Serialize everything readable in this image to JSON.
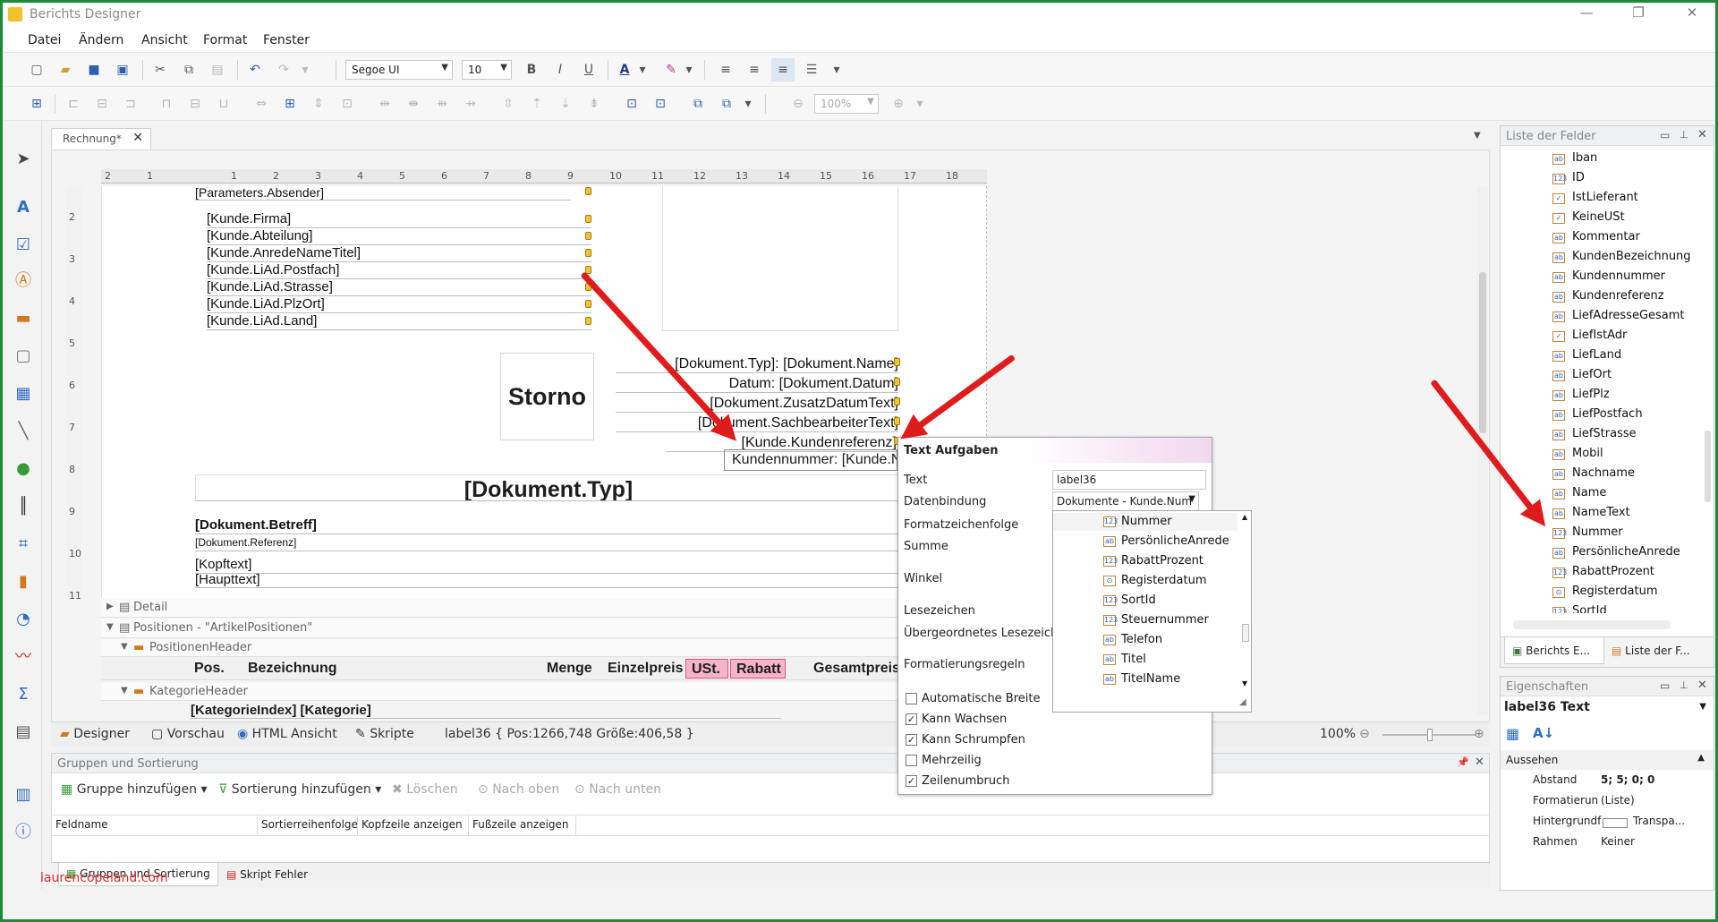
{
  "window": {
    "title": "Berichts Designer",
    "min": "—",
    "max": "❐",
    "close": "✕"
  },
  "menu": [
    "Datei",
    "Ändern",
    "Ansicht",
    "Format",
    "Fenster"
  ],
  "toolbar": {
    "font": "Segoe UI",
    "size": "10",
    "zoom": "100%"
  },
  "doc_tab": {
    "label": "Rechnung*",
    "close": "✕"
  },
  "ruler_h": [
    "2",
    "1",
    "",
    "1",
    "2",
    "3",
    "4",
    "5",
    "6",
    "7",
    "8",
    "9",
    "10",
    "11",
    "12",
    "13",
    "14",
    "15",
    "16",
    "17",
    "18"
  ],
  "ruler_v": [
    "2",
    "3",
    "4",
    "5",
    "6",
    "7",
    "8",
    "9",
    "10",
    "11"
  ],
  "report": {
    "absender": "[Parameters.Absender]",
    "address": [
      "[Kunde.Firma]",
      "[Kunde.Abteilung]",
      "[Kunde.AnredeNameTitel]",
      "[Kunde.LiAd.Postfach]",
      "[Kunde.LiAd.Strasse]",
      "[Kunde.LiAd.PlzOrt]",
      "[Kunde.LiAd.Land]"
    ],
    "storno": "Storno",
    "info": [
      "[Dokument.Typ]: [Dokument.Name]",
      "Datum: [Dokument.Datum]",
      "[Dokument.ZusatzDatumText]",
      "[Dokument.SachbearbeiterText]",
      "[Kunde.Kundenreferenz]"
    ],
    "kundennummer": "Kundennummer: [Kunde.Nummer]",
    "doctyp": "[Dokument.Typ]",
    "betreff": "[Dokument.Betreff]",
    "referenz": "[Dokument.Referenz]",
    "kopftext": "[Kopftext]",
    "haupttext": "[Haupttext]"
  },
  "bands": {
    "detail": "Detail",
    "positionen": "Positionen - \"ArtikelPositionen\"",
    "positionen_header": "PositionenHeader",
    "kategorie_header": "KategorieHeader",
    "kategorie_row": "[KategorieIndex]  [Kategorie]"
  },
  "positions_header": {
    "pos": "Pos.",
    "bez": "Bezeichnung",
    "menge": "Menge",
    "ep": "Einzelpreis",
    "ust": "USt.",
    "rabatt": "Rabatt",
    "gp": "Gesamtpreis"
  },
  "designer_tabs": [
    "Designer",
    "Vorschau",
    "HTML Ansicht",
    "Skripte"
  ],
  "status": {
    "selection": "label36 { Pos:1266,748 Größe:406,58 }",
    "zoom": "100%"
  },
  "popup": {
    "title": "Text Aufgaben",
    "text_label": "Text",
    "text_value": "label36",
    "binding_label": "Datenbindung",
    "binding_value": "Dokumente - Kunde.Num",
    "format_label": "Formatzeichenfolge",
    "summe_label": "Summe",
    "winkel_label": "Winkel",
    "lesezeichen_label": "Lesezeichen",
    "uebergeordnet_label": "Übergeordnetes Lesezeichen",
    "regeln_label": "Formatierungsregeln",
    "checks": [
      {
        "label": "Automatische Breite",
        "checked": false
      },
      {
        "label": "Kann Wachsen",
        "checked": true
      },
      {
        "label": "Kann Schrumpfen",
        "checked": true
      },
      {
        "label": "Mehrzeilig",
        "checked": false
      },
      {
        "label": "Zeilenumbruch",
        "checked": true
      }
    ]
  },
  "dropdown_items": [
    {
      "name": "Nummer",
      "icon": "123"
    },
    {
      "name": "PersönlicheAnrede",
      "icon": "ab"
    },
    {
      "name": "RabattProzent",
      "icon": "123"
    },
    {
      "name": "Registerdatum",
      "icon": "⊙"
    },
    {
      "name": "SortId",
      "icon": "123"
    },
    {
      "name": "Steuernummer",
      "icon": "123"
    },
    {
      "name": "Telefon",
      "icon": "ab"
    },
    {
      "name": "Titel",
      "icon": "ab"
    },
    {
      "name": "TitelName",
      "icon": "ab"
    }
  ],
  "grouping": {
    "title": "Gruppen und Sortierung",
    "add_group": "Gruppe hinzufügen",
    "add_sort": "Sortierung hinzufügen",
    "delete": "Löschen",
    "up": "Nach oben",
    "down": "Nach unten",
    "columns": [
      "Feldname",
      "Sortierreihenfolge",
      "Kopfzeile anzeigen",
      "Fußzeile anzeigen"
    ],
    "tabs": [
      "Gruppen und Sortierung",
      "Skript Fehler"
    ]
  },
  "fieldlist": {
    "title": "Liste der Felder",
    "items": [
      {
        "name": "Iban",
        "icon": "ab"
      },
      {
        "name": "ID",
        "icon": "123"
      },
      {
        "name": "IstLieferant",
        "icon": "✓"
      },
      {
        "name": "KeineUSt",
        "icon": "✓"
      },
      {
        "name": "Kommentar",
        "icon": "ab"
      },
      {
        "name": "KundenBezeichnung",
        "icon": "ab"
      },
      {
        "name": "Kundennummer",
        "icon": "ab"
      },
      {
        "name": "Kundenreferenz",
        "icon": "ab"
      },
      {
        "name": "LiefAdresseGesamt",
        "icon": "ab"
      },
      {
        "name": "LiefIstAdr",
        "icon": "✓"
      },
      {
        "name": "LiefLand",
        "icon": "ab"
      },
      {
        "name": "LiefOrt",
        "icon": "ab"
      },
      {
        "name": "LiefPlz",
        "icon": "ab"
      },
      {
        "name": "LiefPostfach",
        "icon": "ab"
      },
      {
        "name": "LiefStrasse",
        "icon": "ab"
      },
      {
        "name": "Mobil",
        "icon": "ab"
      },
      {
        "name": "Nachname",
        "icon": "ab"
      },
      {
        "name": "Name",
        "icon": "ab"
      },
      {
        "name": "NameText",
        "icon": "ab"
      },
      {
        "name": "Nummer",
        "icon": "123"
      },
      {
        "name": "PersönlicheAnrede",
        "icon": "ab"
      },
      {
        "name": "RabattProzent",
        "icon": "123"
      },
      {
        "name": "Registerdatum",
        "icon": "⊙"
      },
      {
        "name": "SortId",
        "icon": "123"
      }
    ],
    "tabs": [
      "Berichts E...",
      "Liste der F..."
    ]
  },
  "properties": {
    "title": "Eigenschaften",
    "object": "label36  Text",
    "category": "Aussehen",
    "rows": [
      {
        "k": "Abstand",
        "v": "5; 5; 0; 0"
      },
      {
        "k": "Formatierun",
        "v": "(Liste)"
      },
      {
        "k": "Hintergrundf",
        "v": "Transpa..."
      },
      {
        "k": "Rahmen",
        "v": "Keiner"
      }
    ]
  },
  "watermark": "laurencopeland.com",
  "colors": {
    "accent": "#2d6ec6",
    "frame": "#1d8a39",
    "arrow": "#e01b1b",
    "highlight": "#f6b3c9"
  }
}
